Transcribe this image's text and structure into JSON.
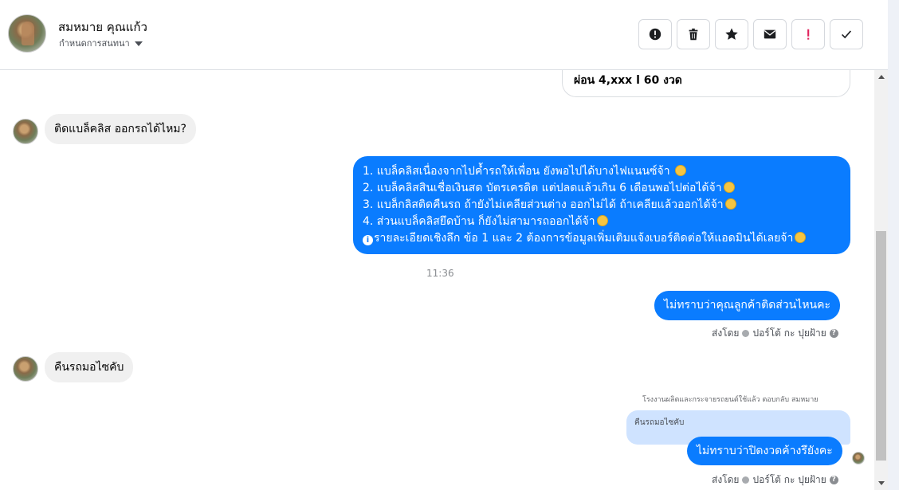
{
  "header": {
    "contact_name": "สมหมาย คุณแก้ว",
    "subtitle": "กำหนดการสนทนา"
  },
  "toolbar": {
    "icons": [
      "alert-circle-icon",
      "trash-icon",
      "star-icon",
      "mail-icon",
      "exclamation-icon",
      "check-icon"
    ],
    "exclamation_color": "#e0245e"
  },
  "messages": {
    "card_text": "ผ่อน 4,xxx l 60 งวด",
    "in1": "ติดแบล็คลิส ออกรถได้ไหม?",
    "out1_lines": [
      "1. แบล็คลิสเนื่องจากไปค้ำรถให้เพื่อน ยังพอไปได้บางไฟแนนซ์จ้า",
      "2. แบล็คลิสสินเชื่อเงินสด บัตรเครดิต แต่ปลดแล้วเกิน 6 เดือนพอไปต่อได้จ้า",
      "3. แบล็กลิสติดคืนรถ ถ้ายังไม่เคลียส่วนต่าง ออกไม่ได้ ถ้าเคลียแล้วออกได้จ้า",
      "4. ส่วนแบล็คลิสยึดบ้าน ก็ยังไม่สามารถออกได้จ้า",
      "รายละเอียดเชิงลึก ข้อ 1 และ 2 ต้องการข้อมูลเพิ่มเติมแจ้งเบอร์ติดต่อให้แอดมินได้เลยจ้า"
    ],
    "time": "11:36",
    "out2": "ไม่ทราบว่าคุณลูกค้าติดส่วนไหนคะ",
    "sent_by_1": "ส่งโดย",
    "sender_1": "ปอร์โต้ กะ ปุยฝ้าย",
    "in2": "คืนรถมอไซคับ",
    "reply_meta": "โรงงานผลิตและกระจายรถยนต์ใช้แล้ว ตอบกลับ สมหมาย",
    "reply_quote": "คืนรถมอไซคับ",
    "out3": "ไม่ทราบว่าปิดงวดค้างรึยังคะ",
    "sent_by_2": "ส่งโดย",
    "sender_2": "ปอร์โต้ กะ ปุยฝ้าย"
  },
  "colors": {
    "outgoing_bubble": "#0a7cff",
    "incoming_bubble": "#f0f0f0",
    "reply_quote_bg": "#cfe3ff"
  }
}
